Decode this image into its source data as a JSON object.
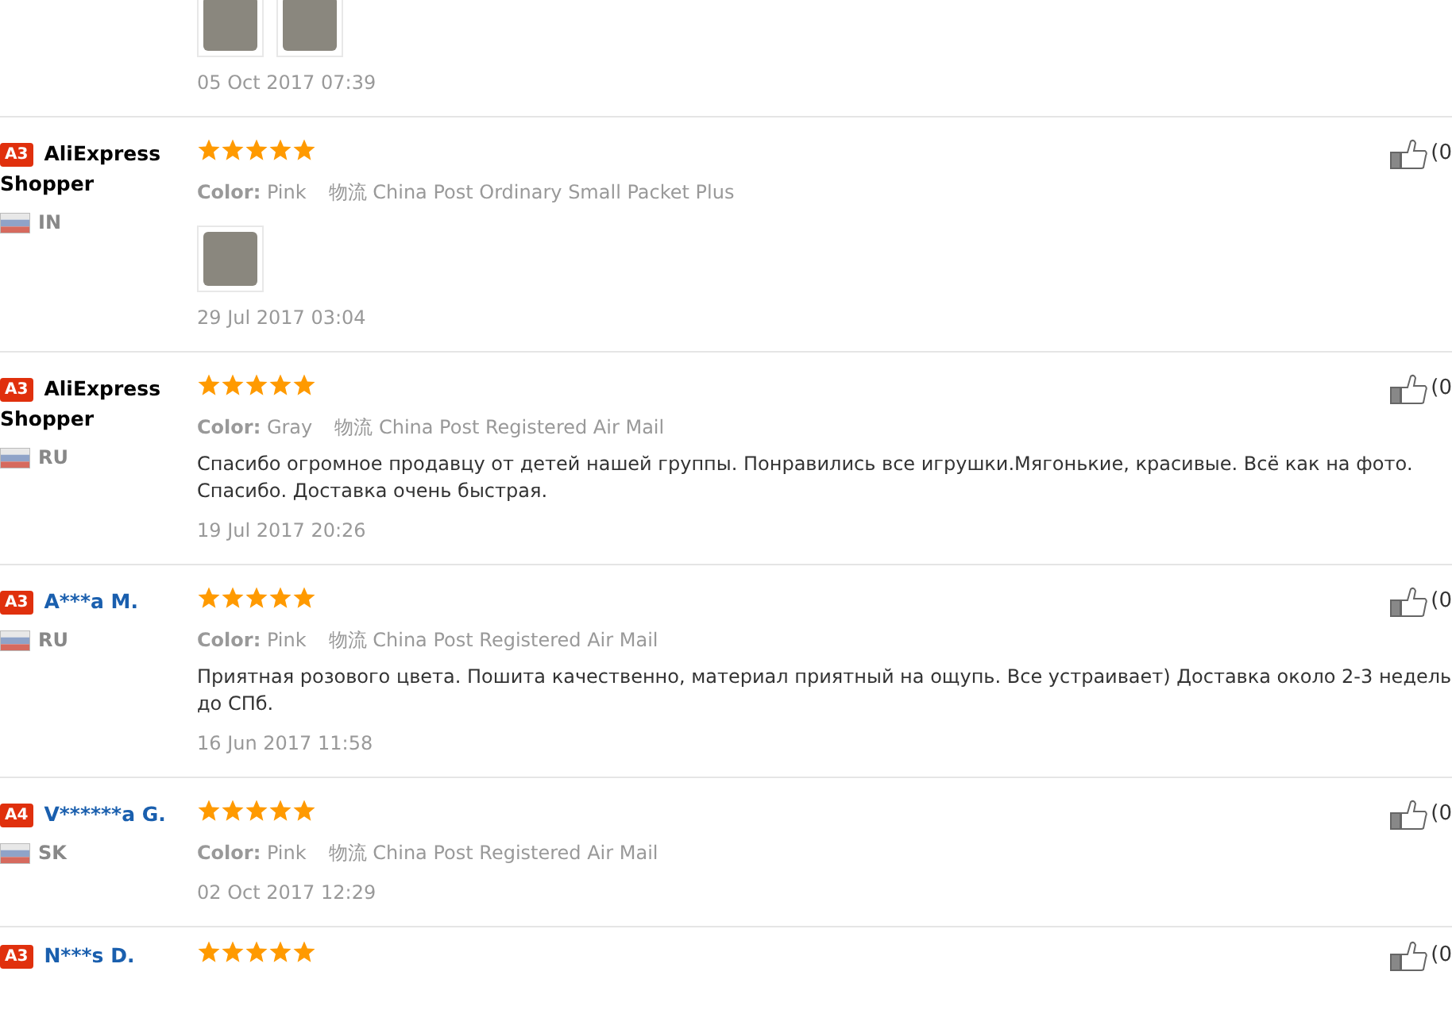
{
  "reviews": [
    {
      "photos": [
        {
          "kind": "photo"
        },
        {
          "kind": "photo"
        }
      ],
      "date": "05 Oct 2017 07:39"
    },
    {
      "badge": "A3",
      "name": "AliExpress Shopper",
      "linked": false,
      "country": "IN",
      "stars": 5,
      "color_label": "Color:",
      "color_value": "Pink",
      "shipping_label": "物流",
      "shipping": "China Post Ordinary Small Packet Plus",
      "photos": [
        {
          "kind": "photo"
        }
      ],
      "date": "29 Jul 2017 03:04",
      "likes": "(0"
    },
    {
      "badge": "A3",
      "name": "AliExpress Shopper",
      "linked": false,
      "country": "RU",
      "stars": 5,
      "color_label": "Color:",
      "color_value": "Gray",
      "shipping_label": "物流",
      "shipping": "China Post Registered Air Mail",
      "text": "Спасибо огромное продавцу от детей нашей группы. Понравились все игрушки.Мягонькие, красивые. Всё как на фото. Спасибо. Доставка очень быстрая.",
      "date": "19 Jul 2017 20:26",
      "likes": "(0"
    },
    {
      "badge": "A3",
      "name": "A***a M.",
      "linked": true,
      "country": "RU",
      "stars": 5,
      "color_label": "Color:",
      "color_value": "Pink",
      "shipping_label": "物流",
      "shipping": "China Post Registered Air Mail",
      "text": "Приятная розового цвета. Пошита качественно, материал приятный на ощупь. Все устраивает) Доставка около 2-3 недель до СПб.",
      "date": "16 Jun 2017 11:58",
      "likes": "(0"
    },
    {
      "badge": "A4",
      "name": "V******a G.",
      "linked": true,
      "country": "SK",
      "stars": 5,
      "color_label": "Color:",
      "color_value": "Pink",
      "shipping_label": "物流",
      "shipping": "China Post Registered Air Mail",
      "date": "02 Oct 2017 12:29",
      "likes": "(0"
    },
    {
      "badge": "A3",
      "name": "N***s D.",
      "linked": true,
      "stars": 5,
      "likes": "(0"
    }
  ]
}
